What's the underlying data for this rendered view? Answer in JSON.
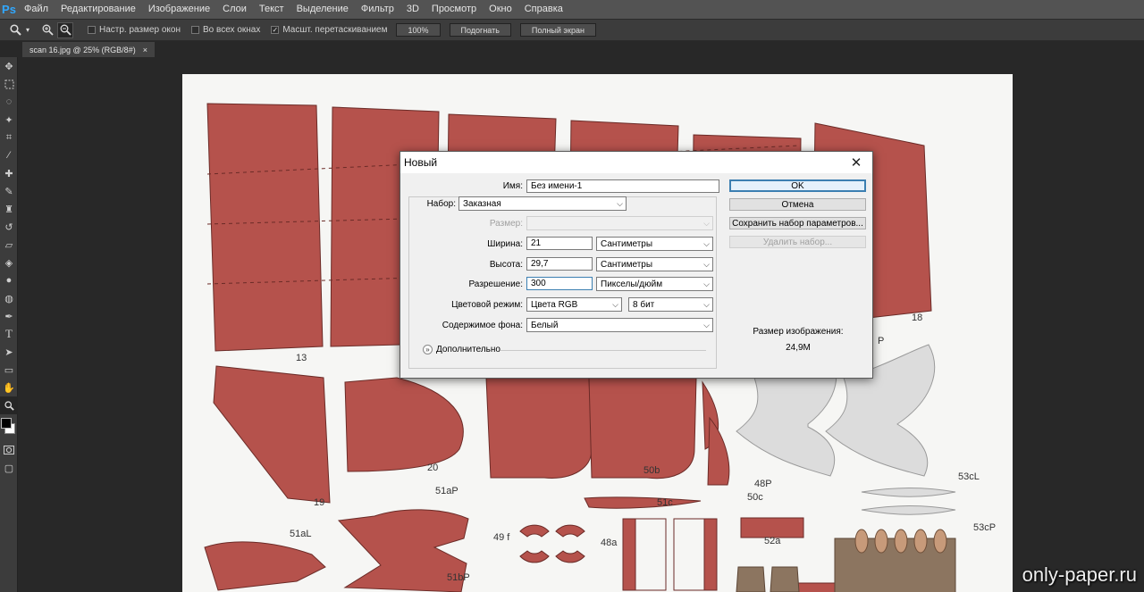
{
  "app": {
    "logo": "Ps"
  },
  "menu": [
    "Файл",
    "Редактирование",
    "Изображение",
    "Слои",
    "Текст",
    "Выделение",
    "Фильтр",
    "3D",
    "Просмотр",
    "Окно",
    "Справка"
  ],
  "options": {
    "resize_windows": "Настр. размер окон",
    "all_windows": "Во всех окнах",
    "scrubby_zoom": "Масшт. перетаскиванием",
    "btn_100": "100%",
    "btn_fit": "Подогнать",
    "btn_full": "Полный экран",
    "resize_checked": false,
    "all_checked": false,
    "scrubby_checked": true
  },
  "document_tab": {
    "title": "scan 16.jpg @ 25% (RGB/8#)",
    "close": "×"
  },
  "canvas": {
    "part_labels": [
      "13",
      "18",
      "19",
      "20",
      "50b",
      "48P",
      "50c",
      "51c",
      "51aP",
      "51aL",
      "49 f",
      "48a",
      "52a",
      "51bP",
      "53cL",
      "53cP",
      "P"
    ],
    "watermark": "only-paper.ru",
    "colors": {
      "part_red": "#b5524c",
      "part_grey": "#dadada",
      "part_brown": "#8c7560",
      "paper": "#f6f6f4"
    }
  },
  "dialog": {
    "title": "Новый",
    "name_label": "Имя:",
    "name_value": "Без имени-1",
    "preset_label": "Набор:",
    "preset_value": "Заказная",
    "size_label": "Размер:",
    "width_label": "Ширина:",
    "width_value": "21",
    "width_unit": "Сантиметры",
    "height_label": "Высота:",
    "height_value": "29,7",
    "height_unit": "Сантиметры",
    "resolution_label": "Разрешение:",
    "resolution_value": "300",
    "resolution_unit": "Пикселы/дюйм",
    "color_mode_label": "Цветовой режим:",
    "color_mode_value": "Цвета RGB",
    "bit_depth_value": "8 бит",
    "background_label": "Содержимое фона:",
    "background_value": "Белый",
    "advanced_label": "Дополнительно",
    "ok": "OK",
    "cancel": "Отмена",
    "save_preset": "Сохранить набор параметров...",
    "delete_preset": "Удалить набор...",
    "image_size_label": "Размер изображения:",
    "image_size_value": "24,9M"
  }
}
